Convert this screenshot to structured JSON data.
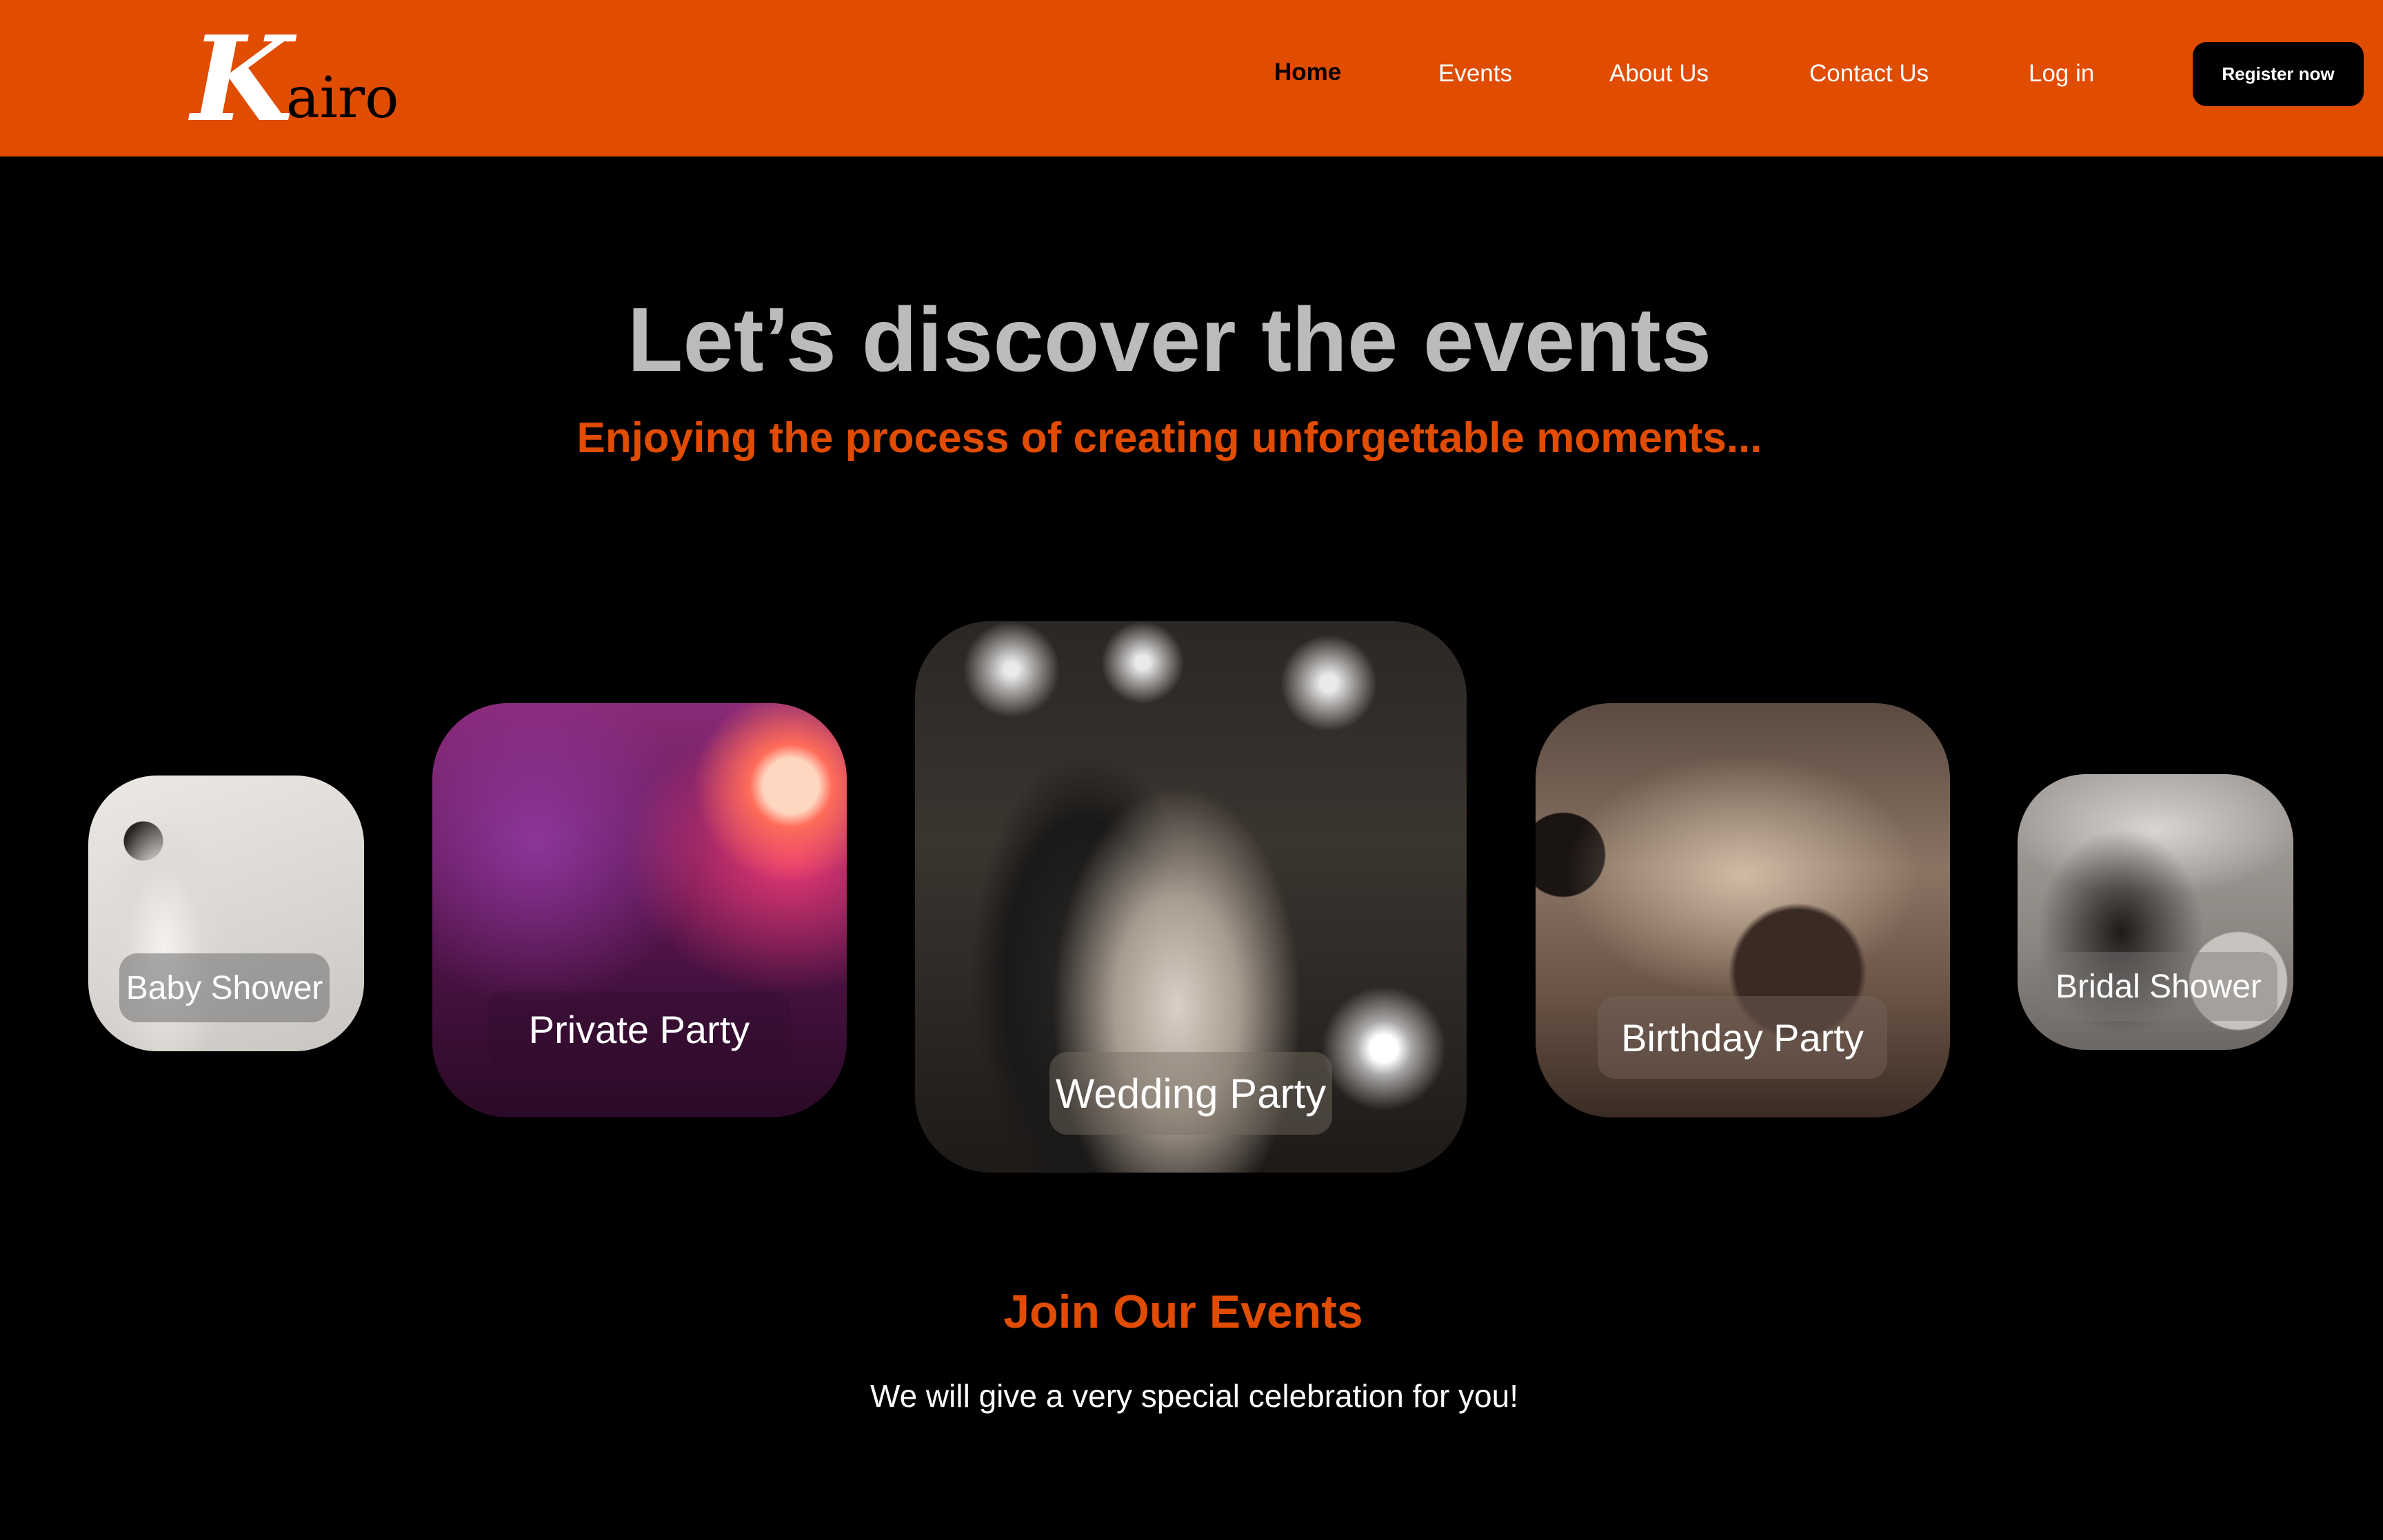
{
  "brand": {
    "logo_initial": "K",
    "logo_rest": "airo"
  },
  "nav": {
    "items": [
      {
        "label": "Home",
        "active": true
      },
      {
        "label": "Events",
        "active": false
      },
      {
        "label": "About Us",
        "active": false
      },
      {
        "label": "Contact Us",
        "active": false
      },
      {
        "label": "Log in",
        "active": false
      }
    ],
    "register_label": "Register now"
  },
  "hero": {
    "title": "Let’s discover the events",
    "subtitle": "Enjoying the process of creating unforgettable moments..."
  },
  "events": [
    {
      "label": "Baby Shower",
      "image": "baby-shower-photo"
    },
    {
      "label": "Private Party",
      "image": "private-party-photo"
    },
    {
      "label": "Wedding Party",
      "image": "wedding-party-photo"
    },
    {
      "label": "Birthday Party",
      "image": "birthday-party-photo"
    },
    {
      "label": "Bridal Shower",
      "image": "bridal-shower-photo"
    }
  ],
  "join": {
    "title": "Join Our Events",
    "text": "We will give a very special celebration for you!"
  },
  "colors": {
    "accent": "#e04c00",
    "background": "#000000",
    "title_gray": "#bdbabb",
    "nav_text": "#ffffff"
  }
}
